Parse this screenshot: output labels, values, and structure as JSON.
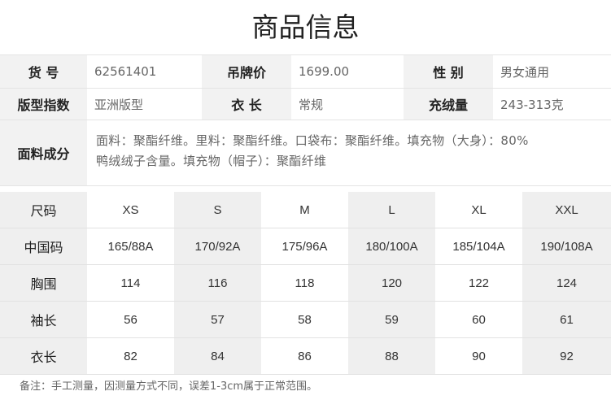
{
  "title": "商品信息",
  "info": {
    "item_no": {
      "label": "货 号",
      "value": "62561401"
    },
    "tag_price": {
      "label": "吊牌价",
      "value": "1699.00"
    },
    "gender": {
      "label": "性 别",
      "value": "男女通用"
    },
    "fit": {
      "label": "版型指数",
      "value": "亚洲版型"
    },
    "length": {
      "label": "衣 长",
      "value": "常规"
    },
    "fill_weight": {
      "label": "充绒量",
      "value": "243-313克"
    },
    "fabric": {
      "label": "面料成分",
      "line1": "面料：聚酯纤维。里料：聚酯纤维。口袋布：聚酯纤维。填充物（大身）：80%",
      "line2": "鸭绒绒子含量。填充物（帽子）：聚酯纤维"
    }
  },
  "size_table": {
    "rows": [
      {
        "label": "尺码",
        "cells": [
          "XS",
          "S",
          "M",
          "L",
          "XL",
          "XXL"
        ]
      },
      {
        "label": "中国码",
        "cells": [
          "165/88A",
          "170/92A",
          "175/96A",
          "180/100A",
          "185/104A",
          "190/108A"
        ]
      },
      {
        "label": "胸围",
        "cells": [
          "114",
          "116",
          "118",
          "120",
          "122",
          "124"
        ]
      },
      {
        "label": "袖长",
        "cells": [
          "56",
          "57",
          "58",
          "59",
          "60",
          "61"
        ]
      },
      {
        "label": "衣长",
        "cells": [
          "82",
          "84",
          "86",
          "88",
          "90",
          "92"
        ]
      }
    ]
  },
  "note": "备注：手工测量，因测量方式不同，误差1-3cm属于正常范围。"
}
